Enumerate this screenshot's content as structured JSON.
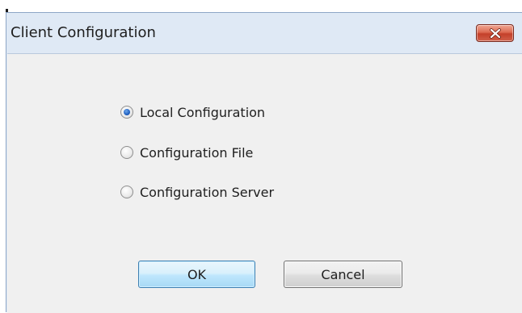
{
  "window": {
    "title": "Client Configuration",
    "close_icon": "close-icon"
  },
  "options": [
    {
      "label": "Local Configuration",
      "selected": true
    },
    {
      "label": "Configuration File",
      "selected": false
    },
    {
      "label": "Configuration Server",
      "selected": false
    }
  ],
  "buttons": {
    "ok_label": "OK",
    "cancel_label": "Cancel"
  },
  "colors": {
    "titlebar": "#dfe9f5",
    "client_area": "#f0f0f0",
    "close_button": "#c4402a",
    "default_button_border": "#3c7fb1"
  }
}
